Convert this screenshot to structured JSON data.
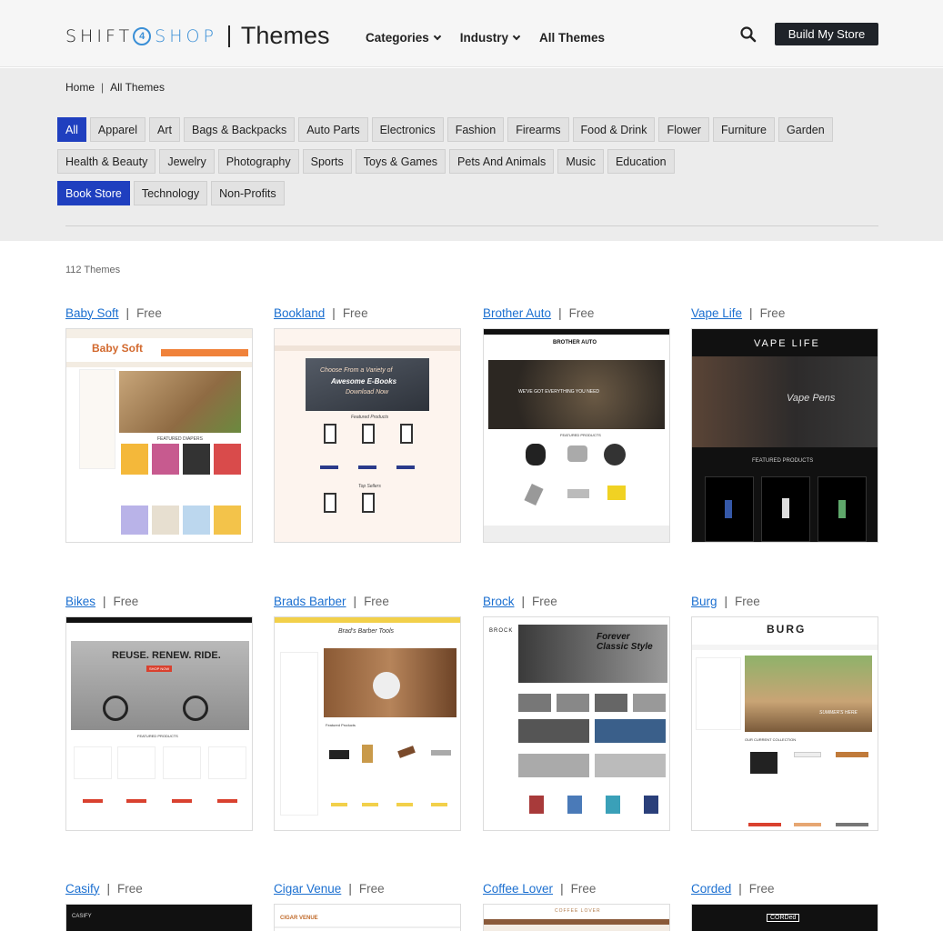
{
  "header": {
    "logo_left": "SHIFT",
    "logo_num": "4",
    "logo_right": "SHOP",
    "logo_section": "Themes",
    "nav": [
      {
        "label": "Categories",
        "has_dropdown": true
      },
      {
        "label": "Industry",
        "has_dropdown": true
      },
      {
        "label": "All Themes",
        "has_dropdown": false
      }
    ],
    "search_icon": "search-icon",
    "cta_label": "Build My Store"
  },
  "breadcrumb": {
    "home": "Home",
    "separator": "|",
    "current": "All Themes"
  },
  "filters": {
    "rows": [
      [
        "All",
        "Apparel",
        "Art",
        "Bags & Backpacks",
        "Auto Parts",
        "Electronics",
        "Fashion",
        "Firearms",
        "Food & Drink",
        "Flower",
        "Furniture",
        "Garden"
      ],
      [
        "Health & Beauty",
        "Jewelry",
        "Photography",
        "Sports",
        "Toys & Games",
        "Pets And Animals",
        "Music",
        "Education"
      ],
      [
        "Book Store",
        "Technology",
        "Non-Profits"
      ]
    ],
    "active": [
      "All",
      "Book Store"
    ],
    "active_color": "#1f3fbf"
  },
  "count_label": "112 Themes",
  "price_separator": "|",
  "themes": [
    {
      "name": "Baby Soft",
      "price": "Free"
    },
    {
      "name": "Bookland",
      "price": "Free"
    },
    {
      "name": "Brother Auto",
      "price": "Free"
    },
    {
      "name": "Vape Life",
      "price": "Free"
    },
    {
      "name": "Bikes",
      "price": "Free"
    },
    {
      "name": "Brads Barber",
      "price": "Free"
    },
    {
      "name": "Brock",
      "price": "Free"
    },
    {
      "name": "Burg",
      "price": "Free"
    },
    {
      "name": "Casify",
      "price": "Free"
    },
    {
      "name": "Cigar Venue",
      "price": "Free"
    },
    {
      "name": "Coffee Lover",
      "price": "Free"
    },
    {
      "name": "Corded",
      "price": "Free"
    }
  ],
  "thumb_text": {
    "babysoft": {
      "logo": "Baby Soft",
      "featured": "FEATURED DIAPERS"
    },
    "bookland": {
      "headline1": "Choose From a Variety of",
      "headline2": "Awesome E-Books",
      "headline3": "Download Now",
      "featured": "Featured Products",
      "top": "Top Sellers"
    },
    "brother": {
      "logo": "BROTHER AUTO",
      "hero": "WE'VE GOT EVERYTHING YOU NEED",
      "featured": "FEATURED PRODUCTS"
    },
    "vape": {
      "logo": "VAPE LIFE",
      "hero": "Vape Pens",
      "featured": "FEATURED PRODUCTS"
    },
    "bikes": {
      "hero": "REUSE. RENEW. RIDE.",
      "cta": "SHOP NOW",
      "featured": "FEATURED PRODUCTS"
    },
    "barber": {
      "logo": "Brad's Barber Tools",
      "featured": "Featured Products"
    },
    "brock": {
      "logo": "BROCK",
      "hero": "Forever Classic Style"
    },
    "burg": {
      "logo": "BURG",
      "hero": "SUMMER'S HERE",
      "collection": "OUR CURRENT COLLECTION"
    },
    "casify": {
      "logo": "CASIFY"
    },
    "cigar": {
      "logo": "CIGAR VENUE"
    },
    "coffee": {
      "logo": "COFFEE LOVER"
    },
    "corded": {
      "logo": "CORDed"
    }
  },
  "colors": {
    "link": "#1b6fd0",
    "cta_bg": "#1f2329",
    "accent": "#3a8fd6"
  }
}
